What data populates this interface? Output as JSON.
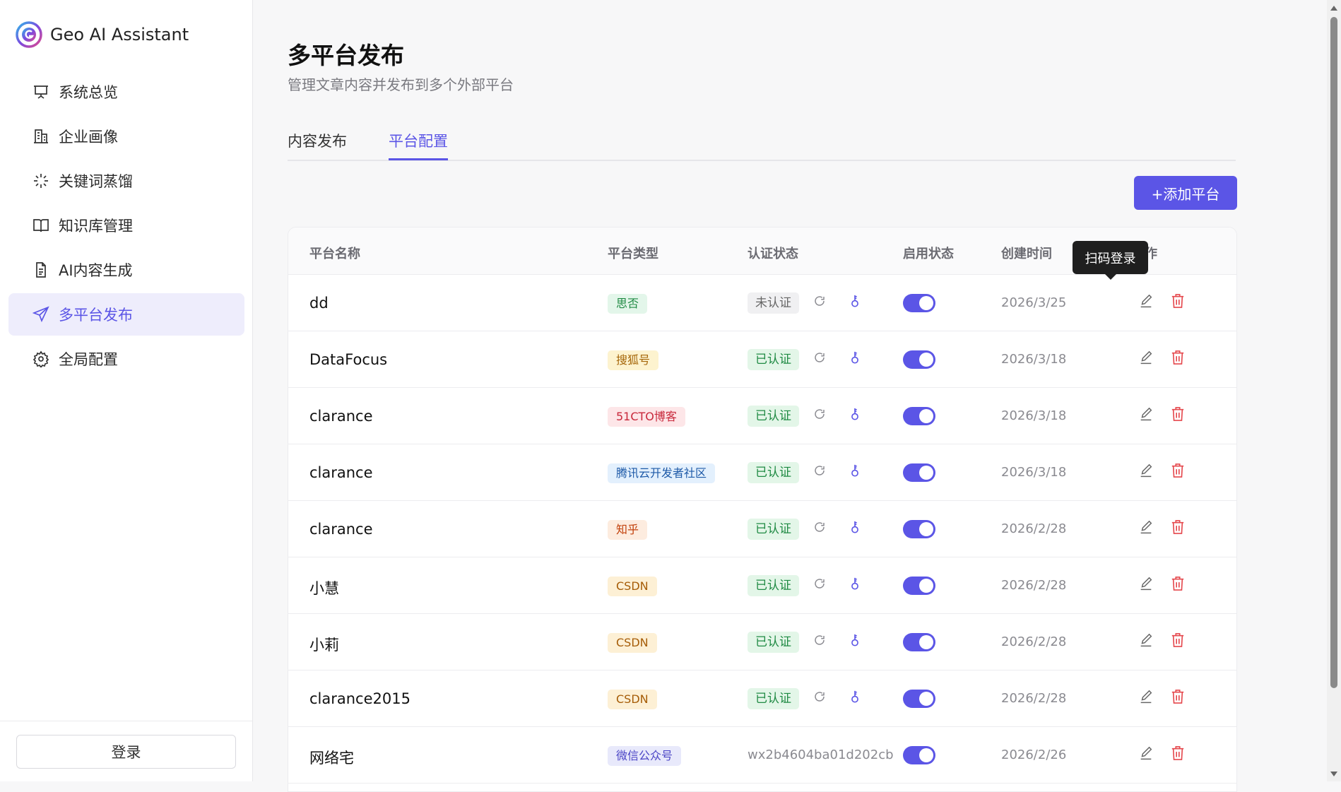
{
  "app": {
    "name": "Geo AI Assistant"
  },
  "sidebar": {
    "items": [
      {
        "label": "系统总览",
        "icon": "presentation-icon",
        "active": false
      },
      {
        "label": "企业画像",
        "icon": "building-icon",
        "active": false
      },
      {
        "label": "关键词蒸馏",
        "icon": "sparkle-icon",
        "active": false
      },
      {
        "label": "知识库管理",
        "icon": "book-open-icon",
        "active": false
      },
      {
        "label": "AI内容生成",
        "icon": "document-icon",
        "active": false
      },
      {
        "label": "多平台发布",
        "icon": "send-icon",
        "active": true
      },
      {
        "label": "全局配置",
        "icon": "gear-icon",
        "active": false
      }
    ],
    "login_label": "登录"
  },
  "page": {
    "title": "多平台发布",
    "subtitle": "管理文章内容并发布到多个外部平台",
    "tabs": [
      {
        "label": "内容发布",
        "active": false
      },
      {
        "label": "平台配置",
        "active": true
      }
    ],
    "add_button": "+添加平台"
  },
  "table": {
    "columns": [
      "平台名称",
      "平台类型",
      "认证状态",
      "启用状态",
      "创建时间",
      "操作"
    ],
    "tooltip": "扫码登录",
    "rows": [
      {
        "name": "dd",
        "type": "思否",
        "type_bg": "#e3f6ea",
        "type_fg": "#1f8a43",
        "auth": "未认证",
        "auth_kind": "no",
        "enabled": true,
        "created": "2026/3/25"
      },
      {
        "name": "DataFocus",
        "type": "搜狐号",
        "type_bg": "#fdf3cf",
        "type_fg": "#a6670a",
        "auth": "已认证",
        "auth_kind": "ok",
        "enabled": true,
        "created": "2026/3/18"
      },
      {
        "name": "clarance",
        "type": "51CTO博客",
        "type_bg": "#fde6e8",
        "type_fg": "#c8283b",
        "auth": "已认证",
        "auth_kind": "ok",
        "enabled": true,
        "created": "2026/3/18"
      },
      {
        "name": "clarance",
        "type": "腾讯云开发者社区",
        "type_bg": "#e3f0fd",
        "type_fg": "#1e5aa8",
        "auth": "已认证",
        "auth_kind": "ok",
        "enabled": true,
        "created": "2026/3/18"
      },
      {
        "name": "clarance",
        "type": "知乎",
        "type_bg": "#fdecdf",
        "type_fg": "#c2410c",
        "auth": "已认证",
        "auth_kind": "ok",
        "enabled": true,
        "created": "2026/2/28"
      },
      {
        "name": "小慧",
        "type": "CSDN",
        "type_bg": "#fdf0d5",
        "type_fg": "#a65d08",
        "auth": "已认证",
        "auth_kind": "ok",
        "enabled": true,
        "created": "2026/2/28"
      },
      {
        "name": "小莉",
        "type": "CSDN",
        "type_bg": "#fdf0d5",
        "type_fg": "#a65d08",
        "auth": "已认证",
        "auth_kind": "ok",
        "enabled": true,
        "created": "2026/2/28"
      },
      {
        "name": "clarance2015",
        "type": "CSDN",
        "type_bg": "#fdf0d5",
        "type_fg": "#a65d08",
        "auth": "已认证",
        "auth_kind": "ok",
        "enabled": true,
        "created": "2026/2/28"
      },
      {
        "name": "网络宅",
        "type": "微信公众号",
        "type_bg": "#e8e9fb",
        "type_fg": "#4b45c6",
        "auth": "wx2b4604ba01d202cb",
        "auth_kind": "appid",
        "enabled": true,
        "created": "2026/2/26"
      }
    ]
  },
  "colors": {
    "accent": "#5b55e6",
    "danger": "#e5484d"
  }
}
